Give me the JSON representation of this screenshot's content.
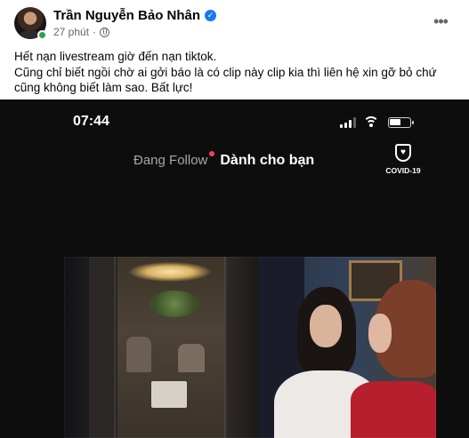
{
  "post": {
    "author_name": "Trần Nguyễn Bảo Nhân",
    "verified_mark": "✓",
    "timestamp": "27 phút",
    "separator": "·",
    "more_label": "•••",
    "text_lines": [
      "Hết nạn livestream giờ đến nạn tiktok.",
      "Cũng chỉ biết ngồi chờ ai gởi báo là có clip này clip kia thì liên hệ xin gỡ bỏ chứ",
      "cũng không biết làm sao. Bất lực!"
    ]
  },
  "media": {
    "status_time": "07:44",
    "tab_following": "Đang Follow",
    "tab_for_you": "Dành cho bạn",
    "covid_label": "COVID-19"
  },
  "icons": {
    "avatar": "profile-photo",
    "verified": "verified-badge-icon",
    "audience": "globe-icon",
    "more": "more-options-icon",
    "signal": "cellular-signal-icon",
    "wifi": "wifi-icon",
    "battery": "battery-icon",
    "covid": "covid-shield-icon"
  },
  "colors": {
    "verified_blue": "#1877f2",
    "online_green": "#31a24c",
    "meta_gray": "#65676b",
    "tiktok_dot": "#ff3b5c"
  }
}
